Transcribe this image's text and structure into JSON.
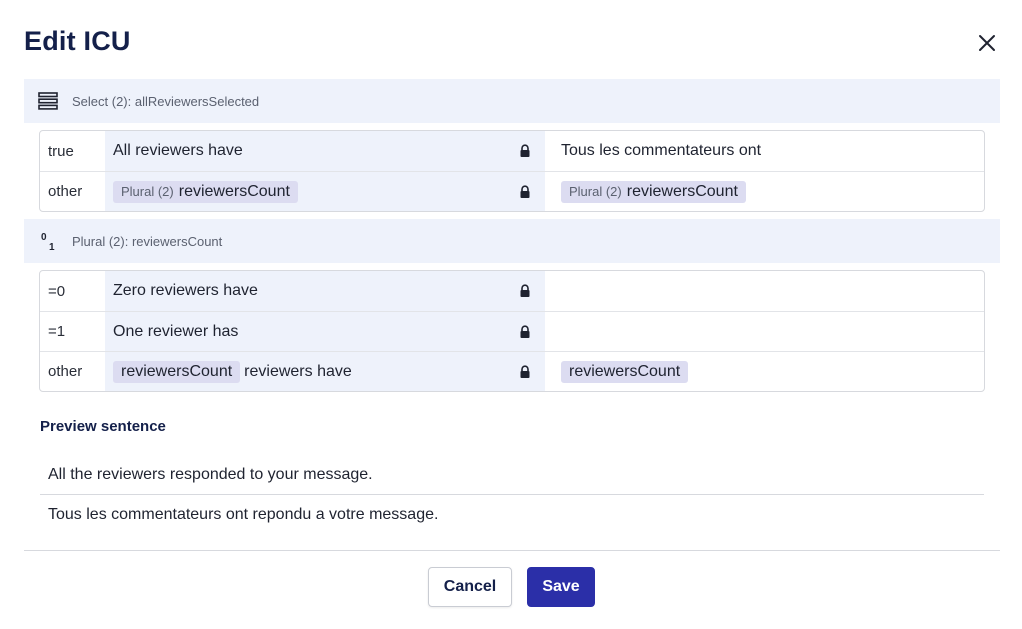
{
  "dialog": {
    "title": "Edit ICU",
    "close_icon": "close-icon"
  },
  "select_section": {
    "icon": "select-list-icon",
    "label": "Select (2): allReviewersSelected",
    "rows": [
      {
        "key": "true",
        "source_text": "All reviewers have",
        "target_text": "Tous les commentateurs ont"
      },
      {
        "key": "other",
        "source_chip_kind": "Plural (2)",
        "source_chip_name": "reviewersCount",
        "target_chip_kind": "Plural (2)",
        "target_chip_name": "reviewersCount"
      }
    ]
  },
  "plural_section": {
    "icon": "plural-icon",
    "label": "Plural (2): reviewersCount",
    "rows": [
      {
        "key": "=0",
        "source_text": "Zero reviewers have",
        "target_text": ""
      },
      {
        "key": "=1",
        "source_text": "One reviewer has",
        "target_text": ""
      },
      {
        "key": "other",
        "source_chip_name": "reviewersCount",
        "source_text": "reviewers have",
        "target_chip_name": "reviewersCount"
      }
    ]
  },
  "preview": {
    "title": "Preview sentence",
    "source_sentence": "All the reviewers responded to your message.",
    "target_sentence": "Tous les commentateurs ont repondu a votre message."
  },
  "footer": {
    "cancel_label": "Cancel",
    "save_label": "Save"
  },
  "colors": {
    "primary": "#2b2fa8",
    "title": "#14204a",
    "source_bg": "#eef2fb",
    "chip_bg": "#dcdcf1"
  }
}
